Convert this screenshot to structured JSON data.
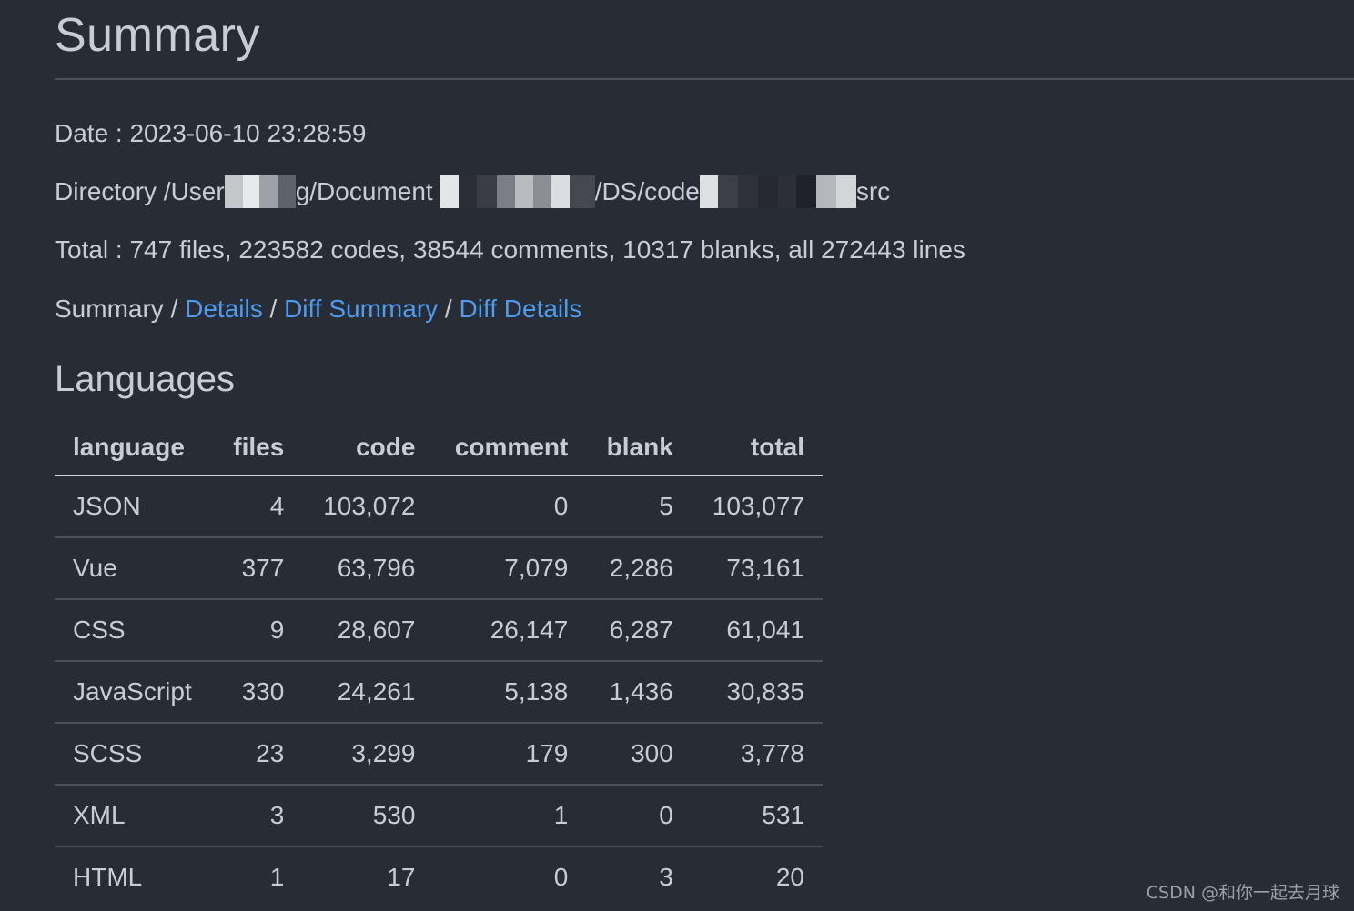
{
  "title": "Summary",
  "date_line": "Date : 2023-06-10 23:28:59",
  "directory": {
    "parts": [
      "Directory /User",
      "g/Document",
      "/DS/code",
      "src"
    ]
  },
  "total_line": "Total : 747 files, 223582 codes, 38544 comments, 10317 blanks, all 272443 lines",
  "nav": {
    "current": "Summary",
    "separator": " / ",
    "links": [
      "Details",
      "Diff Summary",
      "Diff Details"
    ]
  },
  "section_title": "Languages",
  "table": {
    "headers": [
      "language",
      "files",
      "code",
      "comment",
      "blank",
      "total"
    ],
    "rows": [
      [
        "JSON",
        "4",
        "103,072",
        "0",
        "5",
        "103,077"
      ],
      [
        "Vue",
        "377",
        "63,796",
        "7,079",
        "2,286",
        "73,161"
      ],
      [
        "CSS",
        "9",
        "28,607",
        "26,147",
        "6,287",
        "61,041"
      ],
      [
        "JavaScript",
        "330",
        "24,261",
        "5,138",
        "1,436",
        "30,835"
      ],
      [
        "SCSS",
        "23",
        "3,299",
        "179",
        "300",
        "3,778"
      ],
      [
        "XML",
        "3",
        "530",
        "1",
        "0",
        "531"
      ],
      [
        "HTML",
        "1",
        "17",
        "0",
        "3",
        "20"
      ]
    ]
  },
  "watermark": "CSDN @和你一起去月球",
  "colors": {
    "background": "#282c34",
    "text": "#c8ccd4",
    "link": "#4d9cf0",
    "rule": "#4b5059"
  }
}
